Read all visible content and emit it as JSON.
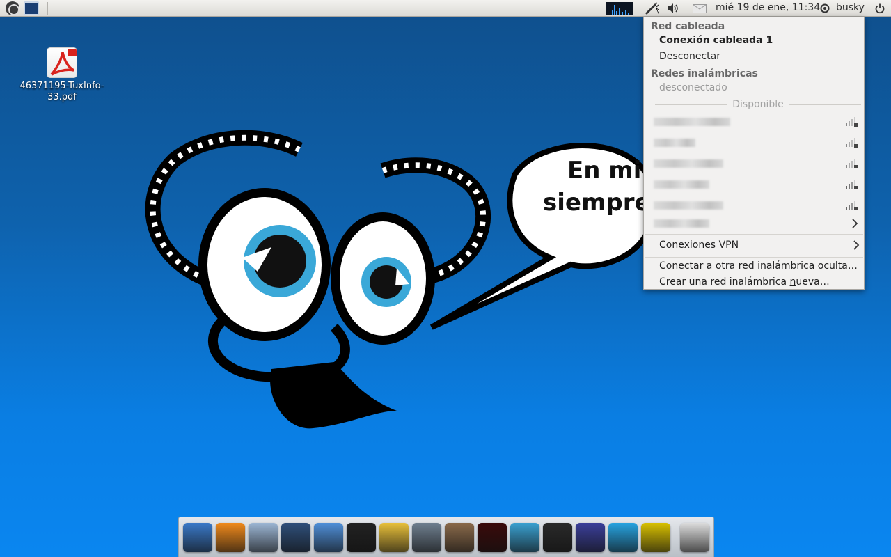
{
  "panel": {
    "clock": "mié 19 de ene, 11:34",
    "user": "busky",
    "icons": [
      "ubuntu-logo-icon",
      "show-desktop-icon",
      "system-monitor-icon",
      "network-icon",
      "volume-icon",
      "mail-icon",
      "user-icon",
      "power-icon"
    ]
  },
  "desktop": {
    "file_label_line1": "46371195-TuxInfo-",
    "file_label_line2": "33.pdf"
  },
  "wallpaper": {
    "speech_line1": "En mi",
    "speech_line2": "siempre"
  },
  "network_menu": {
    "wired_header": "Red cableada",
    "wired_connection": "Conexión cableada 1",
    "disconnect": "Desconectar",
    "wireless_header": "Redes inalámbricas",
    "wireless_status": "desconectado",
    "available": "Disponible",
    "vpn_prefix": "Conexiones ",
    "vpn_mnemonic": "V",
    "vpn_suffix": "PN",
    "hidden_network": "Conectar a otra red inalámbrica oculta…",
    "new_network_prefix": "Crear una red inalámbrica ",
    "new_network_mnemonic": "n",
    "new_network_suffix": "ueva…"
  },
  "dock": {
    "icons": [
      "anchor-icon",
      "eye-icon",
      "home-folder-icon",
      "monitor-icon",
      "writer-icon",
      "terminal-icon",
      "paint-icon",
      "media-player-icon",
      "speaker-icon",
      "record-icon",
      "system-monitor-icon",
      "webcam-icon",
      "earth-icon",
      "skype-icon",
      "arch-icon",
      "trash-icon"
    ],
    "colors": [
      "#3a79c8",
      "#f08a1c",
      "#9cb6d4",
      "#2f4f7a",
      "#4f8fd8",
      "#222222",
      "#e8c03a",
      "#6f7f8f",
      "#8a6a4a",
      "#3a0a0a",
      "#3aa0d0",
      "#2a2a2a",
      "#3b3f9a",
      "#27a3e0",
      "#d8c000",
      "#dcdcdc"
    ]
  }
}
